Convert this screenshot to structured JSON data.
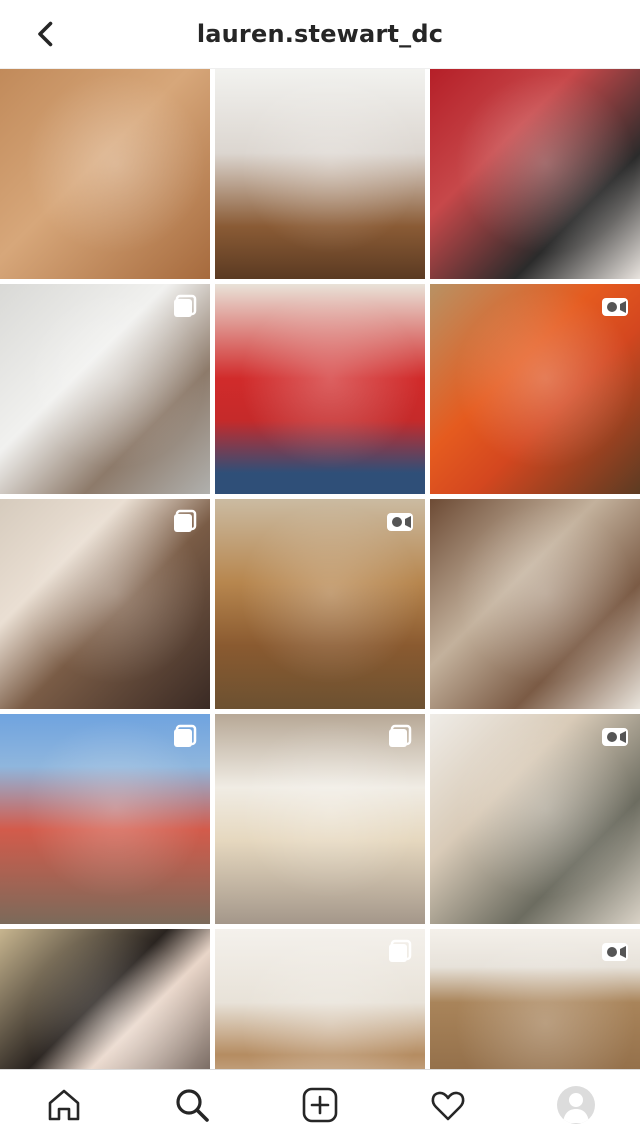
{
  "header": {
    "username": "lauren.stewart_dc",
    "back_icon": "chevron-left-icon"
  },
  "grid": {
    "tiles": [
      {
        "id": 1,
        "badge": null
      },
      {
        "id": 2,
        "badge": null
      },
      {
        "id": 3,
        "badge": null
      },
      {
        "id": 4,
        "badge": "carousel-icon"
      },
      {
        "id": 5,
        "badge": null
      },
      {
        "id": 6,
        "badge": "video-icon"
      },
      {
        "id": 7,
        "badge": "carousel-icon"
      },
      {
        "id": 8,
        "badge": "video-icon"
      },
      {
        "id": 9,
        "badge": null
      },
      {
        "id": 10,
        "badge": "carousel-icon"
      },
      {
        "id": 11,
        "badge": "carousel-icon"
      },
      {
        "id": 12,
        "badge": "video-icon"
      },
      {
        "id": 13,
        "badge": null
      },
      {
        "id": 14,
        "badge": "carousel-icon"
      },
      {
        "id": 15,
        "badge": "video-icon"
      }
    ]
  },
  "tabbar": {
    "items": [
      {
        "name": "home",
        "icon": "home-icon"
      },
      {
        "name": "search",
        "icon": "search-icon"
      },
      {
        "name": "new-post",
        "icon": "plus-square-icon"
      },
      {
        "name": "activity",
        "icon": "heart-icon"
      },
      {
        "name": "profile",
        "icon": "avatar-icon"
      }
    ]
  }
}
